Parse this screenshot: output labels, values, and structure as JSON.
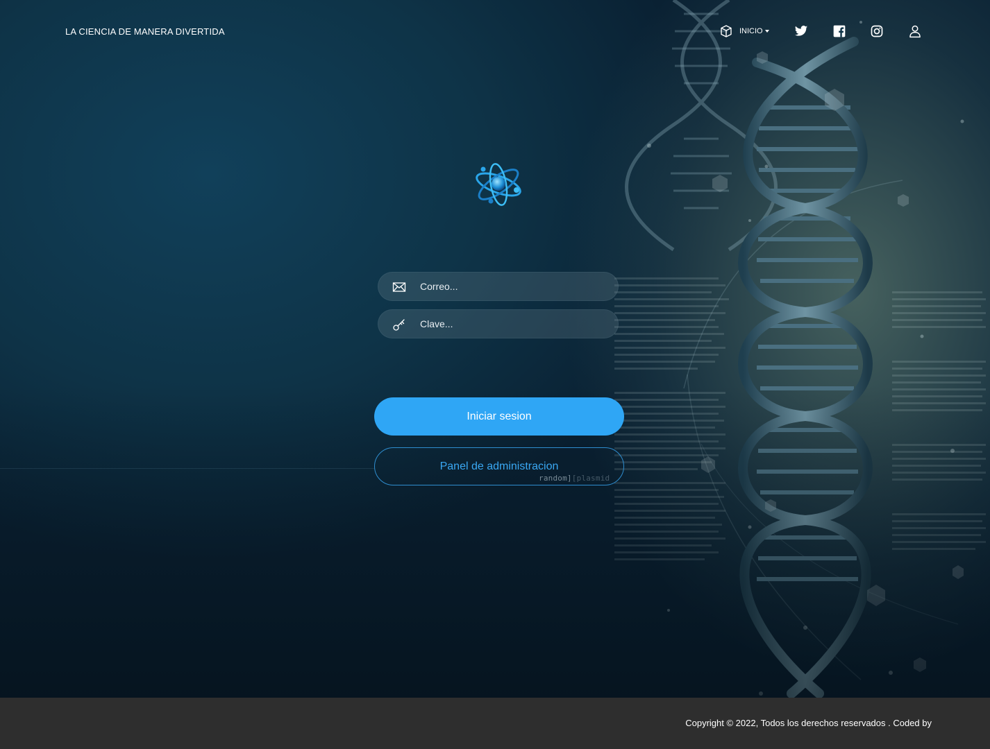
{
  "navbar": {
    "brand": "LA CIENCIA DE MANERA DIVERTIDA",
    "inicio_label": "INICIO",
    "icons": [
      "box-icon",
      "twitter-icon",
      "facebook-icon",
      "instagram-icon",
      "user-icon"
    ]
  },
  "login": {
    "email_placeholder": "Correo...",
    "password_placeholder": "Clave...",
    "login_button": "Iniciar sesion",
    "admin_button": "Panel de administracion"
  },
  "watermark": {
    "part1": "random]",
    "part2": "[plasmid"
  },
  "footer": {
    "copyright": "Copyright © 2022, Todos los derechos reservados . Coded by"
  },
  "colors": {
    "primary_button": "#2fa6f5",
    "outline_button_text": "#3aa8f3",
    "footer_bg": "#2e2e2e",
    "hero_bg": "#0e3347"
  }
}
